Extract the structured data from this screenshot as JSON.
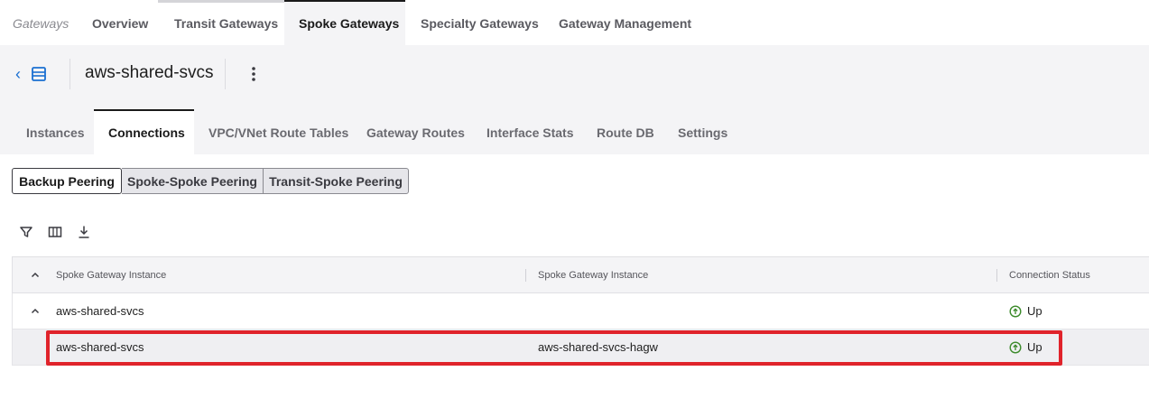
{
  "top_nav": {
    "tabs": [
      "Gateways",
      "Overview",
      "Transit Gateways",
      "Spoke Gateways",
      "Specialty Gateways",
      "Gateway Management"
    ],
    "active": "Spoke Gateways"
  },
  "header": {
    "title": "aws-shared-svcs",
    "back_icon": "chevron-left-icon",
    "list_icon": "list-view-icon",
    "menu_icon": "kebab-menu-icon"
  },
  "sub_tabs": {
    "tabs": [
      "Instances",
      "Connections",
      "VPC/VNet Route Tables",
      "Gateway Routes",
      "Interface Stats",
      "Route DB",
      "Settings"
    ],
    "active": "Connections"
  },
  "peering_toggle": {
    "options": [
      "Backup Peering",
      "Spoke-Spoke Peering",
      "Transit-Spoke Peering"
    ],
    "active": "Backup Peering"
  },
  "toolbar": {
    "icons": [
      "filter-icon",
      "columns-icon",
      "download-icon"
    ]
  },
  "table": {
    "columns": [
      "Spoke Gateway Instance",
      "Spoke Gateway Instance",
      "Connection Status"
    ],
    "group_row": {
      "col1": "aws-shared-svcs",
      "col2": "",
      "status": "Up"
    },
    "rows": [
      {
        "col1": "aws-shared-svcs",
        "col2": "aws-shared-svcs-hagw",
        "status": "Up"
      }
    ]
  },
  "colors": {
    "accent_blue": "#1a6fd1",
    "status_green": "#3b8a2a",
    "highlight_red": "#e0232b"
  }
}
